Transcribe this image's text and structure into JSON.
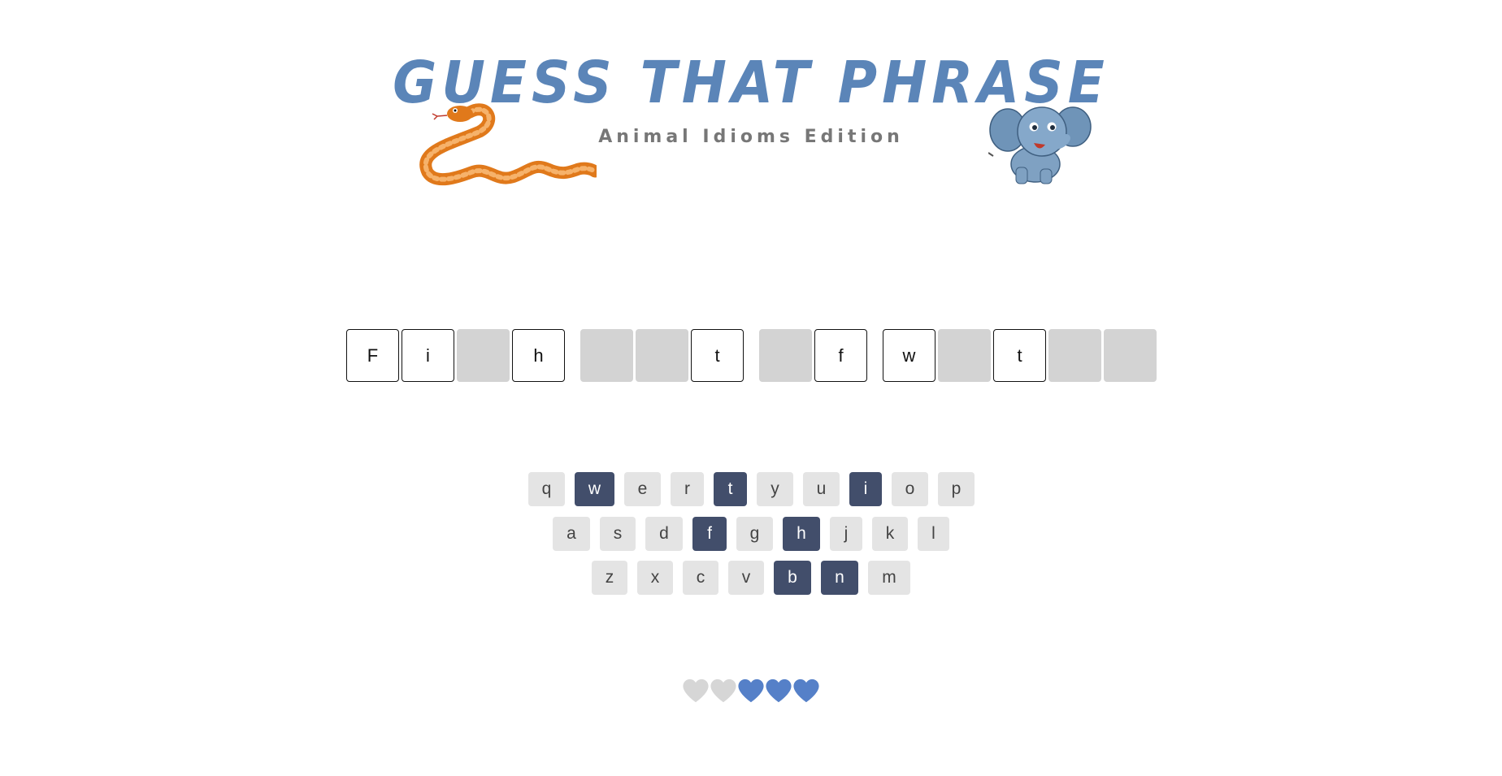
{
  "header": {
    "title": "GUESS THAT PHRASE",
    "subtitle": "Animal Idioms Edition"
  },
  "phrase": {
    "words": [
      [
        {
          "letter": "F",
          "revealed": true
        },
        {
          "letter": "i",
          "revealed": true
        },
        {
          "letter": "",
          "revealed": false
        },
        {
          "letter": "h",
          "revealed": true
        }
      ],
      [
        {
          "letter": "",
          "revealed": false
        },
        {
          "letter": "",
          "revealed": false
        },
        {
          "letter": "t",
          "revealed": true
        }
      ],
      [
        {
          "letter": "",
          "revealed": false
        },
        {
          "letter": "f",
          "revealed": true
        }
      ],
      [
        {
          "letter": "w",
          "revealed": true
        },
        {
          "letter": "",
          "revealed": false
        },
        {
          "letter": "t",
          "revealed": true
        },
        {
          "letter": "",
          "revealed": false
        },
        {
          "letter": "",
          "revealed": false
        }
      ]
    ]
  },
  "keyboard": {
    "rows": [
      [
        {
          "key": "q",
          "used": false
        },
        {
          "key": "w",
          "used": true
        },
        {
          "key": "e",
          "used": false
        },
        {
          "key": "r",
          "used": false
        },
        {
          "key": "t",
          "used": true
        },
        {
          "key": "y",
          "used": false
        },
        {
          "key": "u",
          "used": false
        },
        {
          "key": "i",
          "used": true
        },
        {
          "key": "o",
          "used": false
        },
        {
          "key": "p",
          "used": false
        }
      ],
      [
        {
          "key": "a",
          "used": false
        },
        {
          "key": "s",
          "used": false
        },
        {
          "key": "d",
          "used": false
        },
        {
          "key": "f",
          "used": true
        },
        {
          "key": "g",
          "used": false
        },
        {
          "key": "h",
          "used": true
        },
        {
          "key": "j",
          "used": false
        },
        {
          "key": "k",
          "used": false
        },
        {
          "key": "l",
          "used": false
        }
      ],
      [
        {
          "key": "z",
          "used": false
        },
        {
          "key": "x",
          "used": false
        },
        {
          "key": "c",
          "used": false
        },
        {
          "key": "v",
          "used": false
        },
        {
          "key": "b",
          "used": true
        },
        {
          "key": "n",
          "used": true
        },
        {
          "key": "m",
          "used": false
        }
      ]
    ]
  },
  "lives": {
    "total": 5,
    "remaining": 3,
    "icon": "heart-icon",
    "lost_color": "#d6d6d6",
    "remaining_color": "#5580c8"
  },
  "colors": {
    "title": "#5b85b8",
    "subtitle": "#777777",
    "key_default": "#e4e4e4",
    "key_used": "#424e6b",
    "tile_hidden": "#d3d3d3"
  },
  "images": {
    "left": "snake-illustration",
    "right": "elephant-illustration"
  }
}
